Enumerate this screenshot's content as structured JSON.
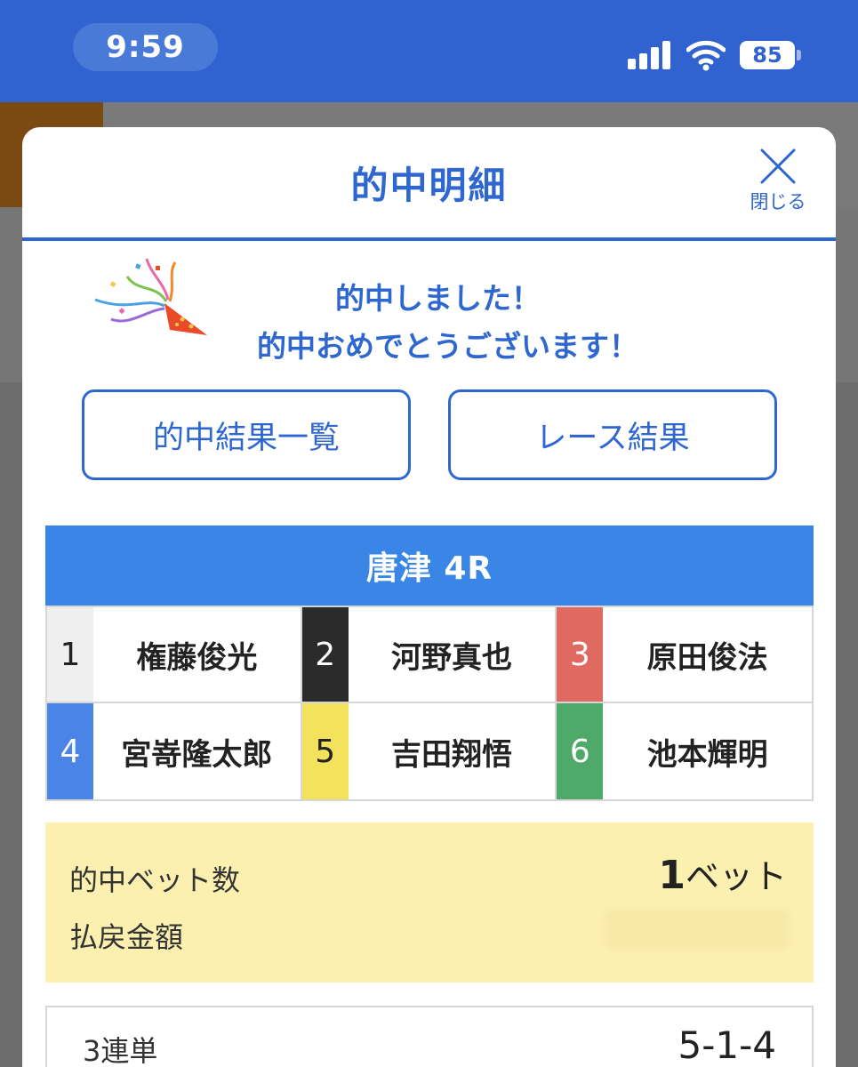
{
  "status_bar": {
    "time": "9:59",
    "battery": "85"
  },
  "modal": {
    "title": "的中明細",
    "close_label": "閉じる"
  },
  "congrats": {
    "line1": "的中しました！",
    "line2": "的中おめでとうございます！"
  },
  "buttons": {
    "hit_list": "的中結果一覧",
    "race_result": "レース結果"
  },
  "race": {
    "title": "唐津 4R",
    "racers": [
      {
        "lane": "1",
        "name": "権藤俊光",
        "lane_bg": "#efefef",
        "lane_fg": "#222222"
      },
      {
        "lane": "2",
        "name": "河野真也",
        "lane_bg": "#2b2b2b",
        "lane_fg": "#ffffff"
      },
      {
        "lane": "3",
        "name": "原田俊法",
        "lane_bg": "#e06a62",
        "lane_fg": "#ffffff"
      },
      {
        "lane": "4",
        "name": "宮嵜隆太郎",
        "lane_bg": "#4a84e6",
        "lane_fg": "#ffffff"
      },
      {
        "lane": "5",
        "name": "吉田翔悟",
        "lane_bg": "#f3e35c",
        "lane_fg": "#222222"
      },
      {
        "lane": "6",
        "name": "池本輝明",
        "lane_bg": "#4faa6a",
        "lane_fg": "#ffffff"
      }
    ]
  },
  "summary": {
    "bet_count_label": "的中ベット数",
    "bet_count_value": "1",
    "bet_count_unit": "ベット",
    "payout_label": "払戻金額"
  },
  "bet": {
    "type": "3連単",
    "combination": "5-1-4"
  },
  "colors": {
    "brand_blue": "#2f67d0",
    "race_header": "#3a86e6",
    "summary_bg": "#fcf0b0"
  }
}
